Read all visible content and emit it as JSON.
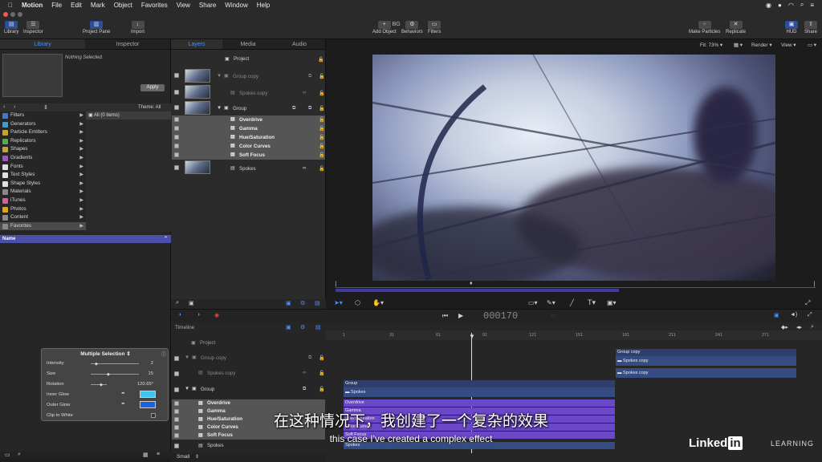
{
  "menubar": {
    "app": "Motion",
    "items": [
      "File",
      "Edit",
      "Mark",
      "Object",
      "Favorites",
      "View",
      "Share",
      "Window",
      "Help"
    ]
  },
  "window": {
    "title": "BG"
  },
  "toolbar": {
    "library": "Library",
    "inspector": "Inspector",
    "project_pane": "Project Pane",
    "import": "Import",
    "add_object": "Add Object",
    "behaviors": "Behaviors",
    "filters": "Filters",
    "make_particles": "Make Particles",
    "replicate": "Replicate",
    "hud": "HUD",
    "share": "Share"
  },
  "left_panel": {
    "tabs": [
      "Library",
      "Inspector"
    ],
    "nothing_selected": "Nothing Selected.",
    "apply": "Apply",
    "theme": "Theme: All",
    "categories": [
      "Filters",
      "Generators",
      "Particle Emitters",
      "Replicators",
      "Shapes",
      "Gradients",
      "Fonts",
      "Text Styles",
      "Shape Styles",
      "Materials",
      "iTunes",
      "Photos",
      "Content",
      "Favorites"
    ],
    "category_colors": [
      "#3a7bd5",
      "#3a9bd5",
      "#c9a227",
      "#4ab04a",
      "#c9a227",
      "#9b59b6",
      "#e0e0e0",
      "#e0e0e0",
      "#e0e0e0",
      "#888888",
      "#e05a9a",
      "#e0a020",
      "#888888",
      "#888888"
    ],
    "all_items": "All (0 items)",
    "name_col": "Name"
  },
  "layers_panel": {
    "tabs": [
      "Layers",
      "Media",
      "Audio"
    ],
    "project": "Project",
    "rows": [
      "Group copy",
      "Spokes copy",
      "Group",
      "Overdrive",
      "Gamma",
      "Hue/Saturation",
      "Color Curves",
      "Soft Focus",
      "Spokes"
    ]
  },
  "canvas": {
    "fit": "Fit: 73%",
    "render": "Render",
    "view": "View"
  },
  "transport": {
    "timecode": "000170"
  },
  "timeline": {
    "label": "Timeline",
    "ruler": [
      "1",
      "31",
      "61",
      "91",
      "121",
      "151",
      "181",
      "211",
      "241",
      "271"
    ],
    "rows": [
      "Project",
      "Group copy",
      "Spokes copy",
      "Group",
      "Overdrive",
      "Gamma",
      "Hue/Saturation",
      "Color Curves",
      "Soft Focus",
      "Spokes"
    ],
    "bars": {
      "group_copy": "Group copy",
      "spokes_copy_1": "Spokes copy",
      "spokes_copy_2": "Spokes copy",
      "group": "Group",
      "spokes": "Spokes",
      "overdrive": "Overdrive",
      "gamma": "Gamma",
      "hue": "Hue/Saturation",
      "curves": "Color Curves",
      "soft": "Soft Focus",
      "spokes2": "Spokes"
    },
    "zoom": "Small"
  },
  "hud": {
    "title": "Multiple Selection",
    "intensity_label": "Intensity",
    "intensity": "2",
    "size_label": "Size",
    "size": "15",
    "rotation_label": "Rotation",
    "rotation": "120.65°",
    "inner_glow": "Inner Glow",
    "outer_glow": "Outer Glow",
    "clip": "Clip to White",
    "inner_color": "#3fc6f0",
    "outer_color": "#1a63e0"
  },
  "subtitles": {
    "cn": "在这种情况下，我创建了一个复杂的效果",
    "en": "this case I've created a complex effect"
  },
  "watermark": {
    "brand": "Linked",
    "brand_in": "in",
    "learning": "LEARNING"
  }
}
